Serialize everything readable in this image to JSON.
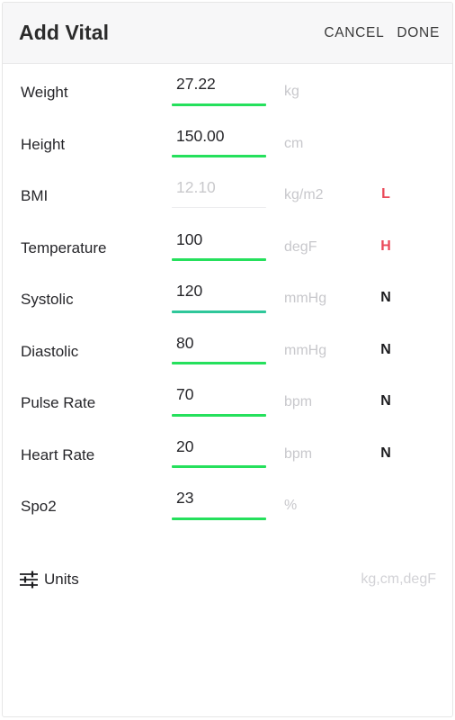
{
  "header": {
    "title": "Add Vital",
    "cancel_label": "CANCEL",
    "done_label": "DONE"
  },
  "colors": {
    "underline_active": "#25e05c",
    "underline_focused": "#2fc79a",
    "underline_disabled": "#ececee",
    "flag_abnormal": "#ea4a5a",
    "flag_normal": "#1c1c1f",
    "placeholder_text": "#c8c8cc",
    "header_background": "#f7f7f8"
  },
  "vitals": [
    {
      "label": "Weight",
      "value": "27.22",
      "unit": "kg",
      "flag": "",
      "flag_kind": "none",
      "underline": "active",
      "disabled": false
    },
    {
      "label": "Height",
      "value": "150.00",
      "unit": "cm",
      "flag": "",
      "flag_kind": "none",
      "underline": "active",
      "disabled": false
    },
    {
      "label": "BMI",
      "value": "12.10",
      "unit": "kg/m2",
      "flag": "L",
      "flag_kind": "abnormal",
      "underline": "disabled",
      "disabled": true
    },
    {
      "label": "Temperature",
      "value": "100",
      "unit": "degF",
      "flag": "H",
      "flag_kind": "abnormal",
      "underline": "active",
      "disabled": false
    },
    {
      "label": "Systolic",
      "value": "120",
      "unit": "mmHg",
      "flag": "N",
      "flag_kind": "normal",
      "underline": "focused",
      "disabled": false
    },
    {
      "label": "Diastolic",
      "value": "80",
      "unit": "mmHg",
      "flag": "N",
      "flag_kind": "normal",
      "underline": "active",
      "disabled": false
    },
    {
      "label": "Pulse Rate",
      "value": "70",
      "unit": "bpm",
      "flag": "N",
      "flag_kind": "normal",
      "underline": "active",
      "disabled": false
    },
    {
      "label": "Heart Rate",
      "value": "20",
      "unit": "bpm",
      "flag": "N",
      "flag_kind": "normal",
      "underline": "active",
      "disabled": false
    },
    {
      "label": "Spo2",
      "value": "23",
      "unit": "%",
      "flag": "",
      "flag_kind": "none",
      "underline": "active",
      "disabled": false
    }
  ],
  "units_row": {
    "icon": "tune-icon",
    "label": "Units",
    "value": "kg,cm,degF"
  }
}
